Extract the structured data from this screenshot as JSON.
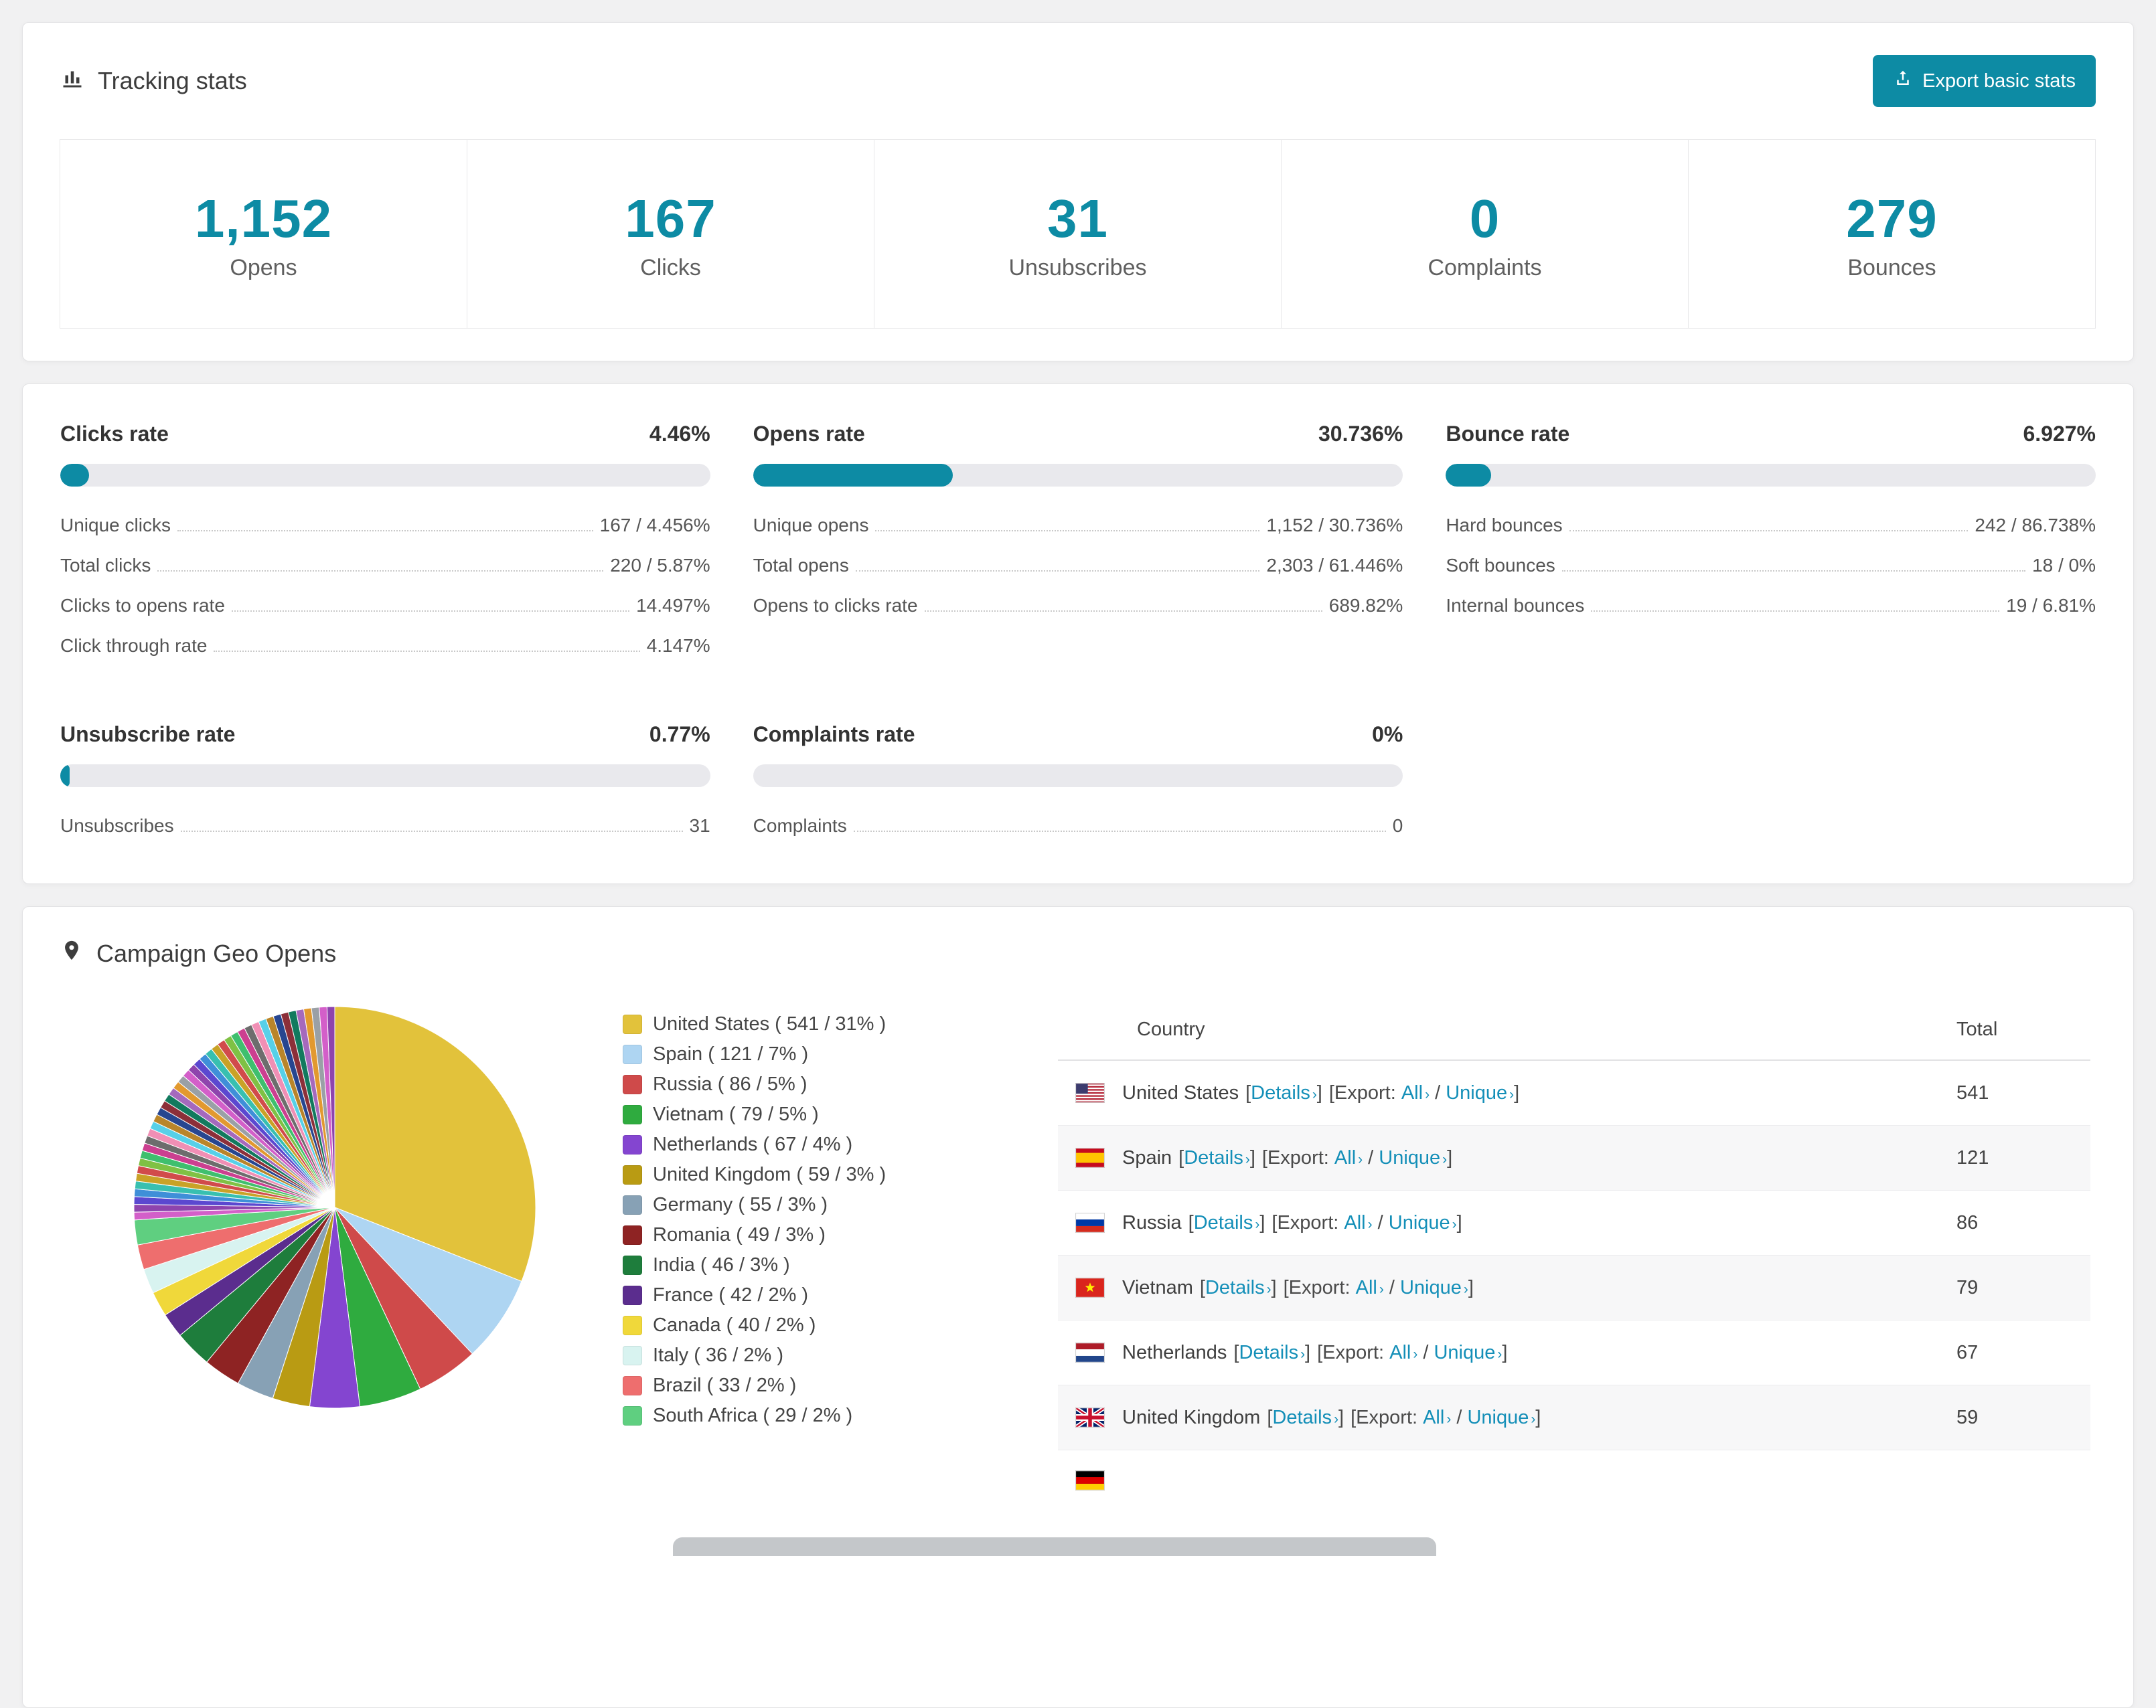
{
  "colors": {
    "accent": "#0d8ba4",
    "link": "#148fb8"
  },
  "header": {
    "title": "Tracking stats",
    "export_button": "Export basic stats"
  },
  "stats": [
    {
      "value": "1,152",
      "label": "Opens"
    },
    {
      "value": "167",
      "label": "Clicks"
    },
    {
      "value": "31",
      "label": "Unsubscribes"
    },
    {
      "value": "0",
      "label": "Complaints"
    },
    {
      "value": "279",
      "label": "Bounces"
    }
  ],
  "rates": {
    "clicks": {
      "title": "Clicks rate",
      "percent_label": "4.46%",
      "percent": 4.46,
      "rows": [
        {
          "label": "Unique clicks",
          "value": "167 / 4.456%"
        },
        {
          "label": "Total clicks",
          "value": "220 / 5.87%"
        },
        {
          "label": "Clicks to opens rate",
          "value": "14.497%"
        },
        {
          "label": "Click through rate",
          "value": "4.147%"
        }
      ]
    },
    "opens": {
      "title": "Opens rate",
      "percent_label": "30.736%",
      "percent": 30.736,
      "rows": [
        {
          "label": "Unique opens",
          "value": "1,152 / 30.736%"
        },
        {
          "label": "Total opens",
          "value": "2,303 / 61.446%"
        },
        {
          "label": "Opens to clicks rate",
          "value": "689.82%"
        }
      ]
    },
    "bounce": {
      "title": "Bounce rate",
      "percent_label": "6.927%",
      "percent": 6.927,
      "rows": [
        {
          "label": "Hard bounces",
          "value": "242 / 86.738%"
        },
        {
          "label": "Soft bounces",
          "value": "18 / 0%"
        },
        {
          "label": "Internal bounces",
          "value": "19 / 6.81%"
        }
      ]
    },
    "unsubscribe": {
      "title": "Unsubscribe rate",
      "percent_label": "0.77%",
      "percent": 0.77,
      "rows": [
        {
          "label": "Unsubscribes",
          "value": "31"
        }
      ]
    },
    "complaints": {
      "title": "Complaints rate",
      "percent_label": "0%",
      "percent": 0,
      "rows": [
        {
          "label": "Complaints",
          "value": "0"
        }
      ]
    }
  },
  "geo": {
    "title": "Campaign Geo Opens",
    "table": {
      "columns": {
        "country": "Country",
        "total": "Total"
      },
      "labels": {
        "details": "Details",
        "export": "Export:",
        "all": "All",
        "unique": "Unique",
        "open_bracket": "[",
        "close_bracket": "]",
        "slash": "/",
        "chevron": "›"
      },
      "rows": [
        {
          "country": "United States",
          "total": "541",
          "flag": "us"
        },
        {
          "country": "Spain",
          "total": "121",
          "flag": "es"
        },
        {
          "country": "Russia",
          "total": "86",
          "flag": "ru"
        },
        {
          "country": "Vietnam",
          "total": "79",
          "flag": "vn"
        },
        {
          "country": "Netherlands",
          "total": "67",
          "flag": "nl"
        },
        {
          "country": "United Kingdom",
          "total": "59",
          "flag": "gb"
        },
        {
          "country": "",
          "total": "",
          "flag": "de",
          "partial": true
        }
      ]
    }
  },
  "chart_data": {
    "type": "pie",
    "title": "Campaign Geo Opens",
    "legend_position": "right",
    "series": [
      {
        "label": "United States",
        "value": 541,
        "percent": 31,
        "color": "#e2c23b"
      },
      {
        "label": "Spain",
        "value": 121,
        "percent": 7,
        "color": "#aed5f2"
      },
      {
        "label": "Russia",
        "value": 86,
        "percent": 5,
        "color": "#cf4a4a"
      },
      {
        "label": "Vietnam",
        "value": 79,
        "percent": 5,
        "color": "#2fab3f"
      },
      {
        "label": "Netherlands",
        "value": 67,
        "percent": 4,
        "color": "#8445d0"
      },
      {
        "label": "United Kingdom",
        "value": 59,
        "percent": 3,
        "color": "#b99b13"
      },
      {
        "label": "Germany",
        "value": 55,
        "percent": 3,
        "color": "#87a1b5"
      },
      {
        "label": "Romania",
        "value": 49,
        "percent": 3,
        "color": "#8e2323"
      },
      {
        "label": "India",
        "value": 46,
        "percent": 3,
        "color": "#1e7d3c"
      },
      {
        "label": "France",
        "value": 42,
        "percent": 2,
        "color": "#5b2d8e"
      },
      {
        "label": "Canada",
        "value": 40,
        "percent": 2,
        "color": "#f0d83a"
      },
      {
        "label": "Italy",
        "value": 36,
        "percent": 2,
        "color": "#d8f3f0"
      },
      {
        "label": "Brazil",
        "value": 33,
        "percent": 2,
        "color": "#ee6e6e"
      },
      {
        "label": "South Africa",
        "value": 29,
        "percent": 2,
        "color": "#5fcf80"
      }
    ],
    "others_percent": 26
  }
}
